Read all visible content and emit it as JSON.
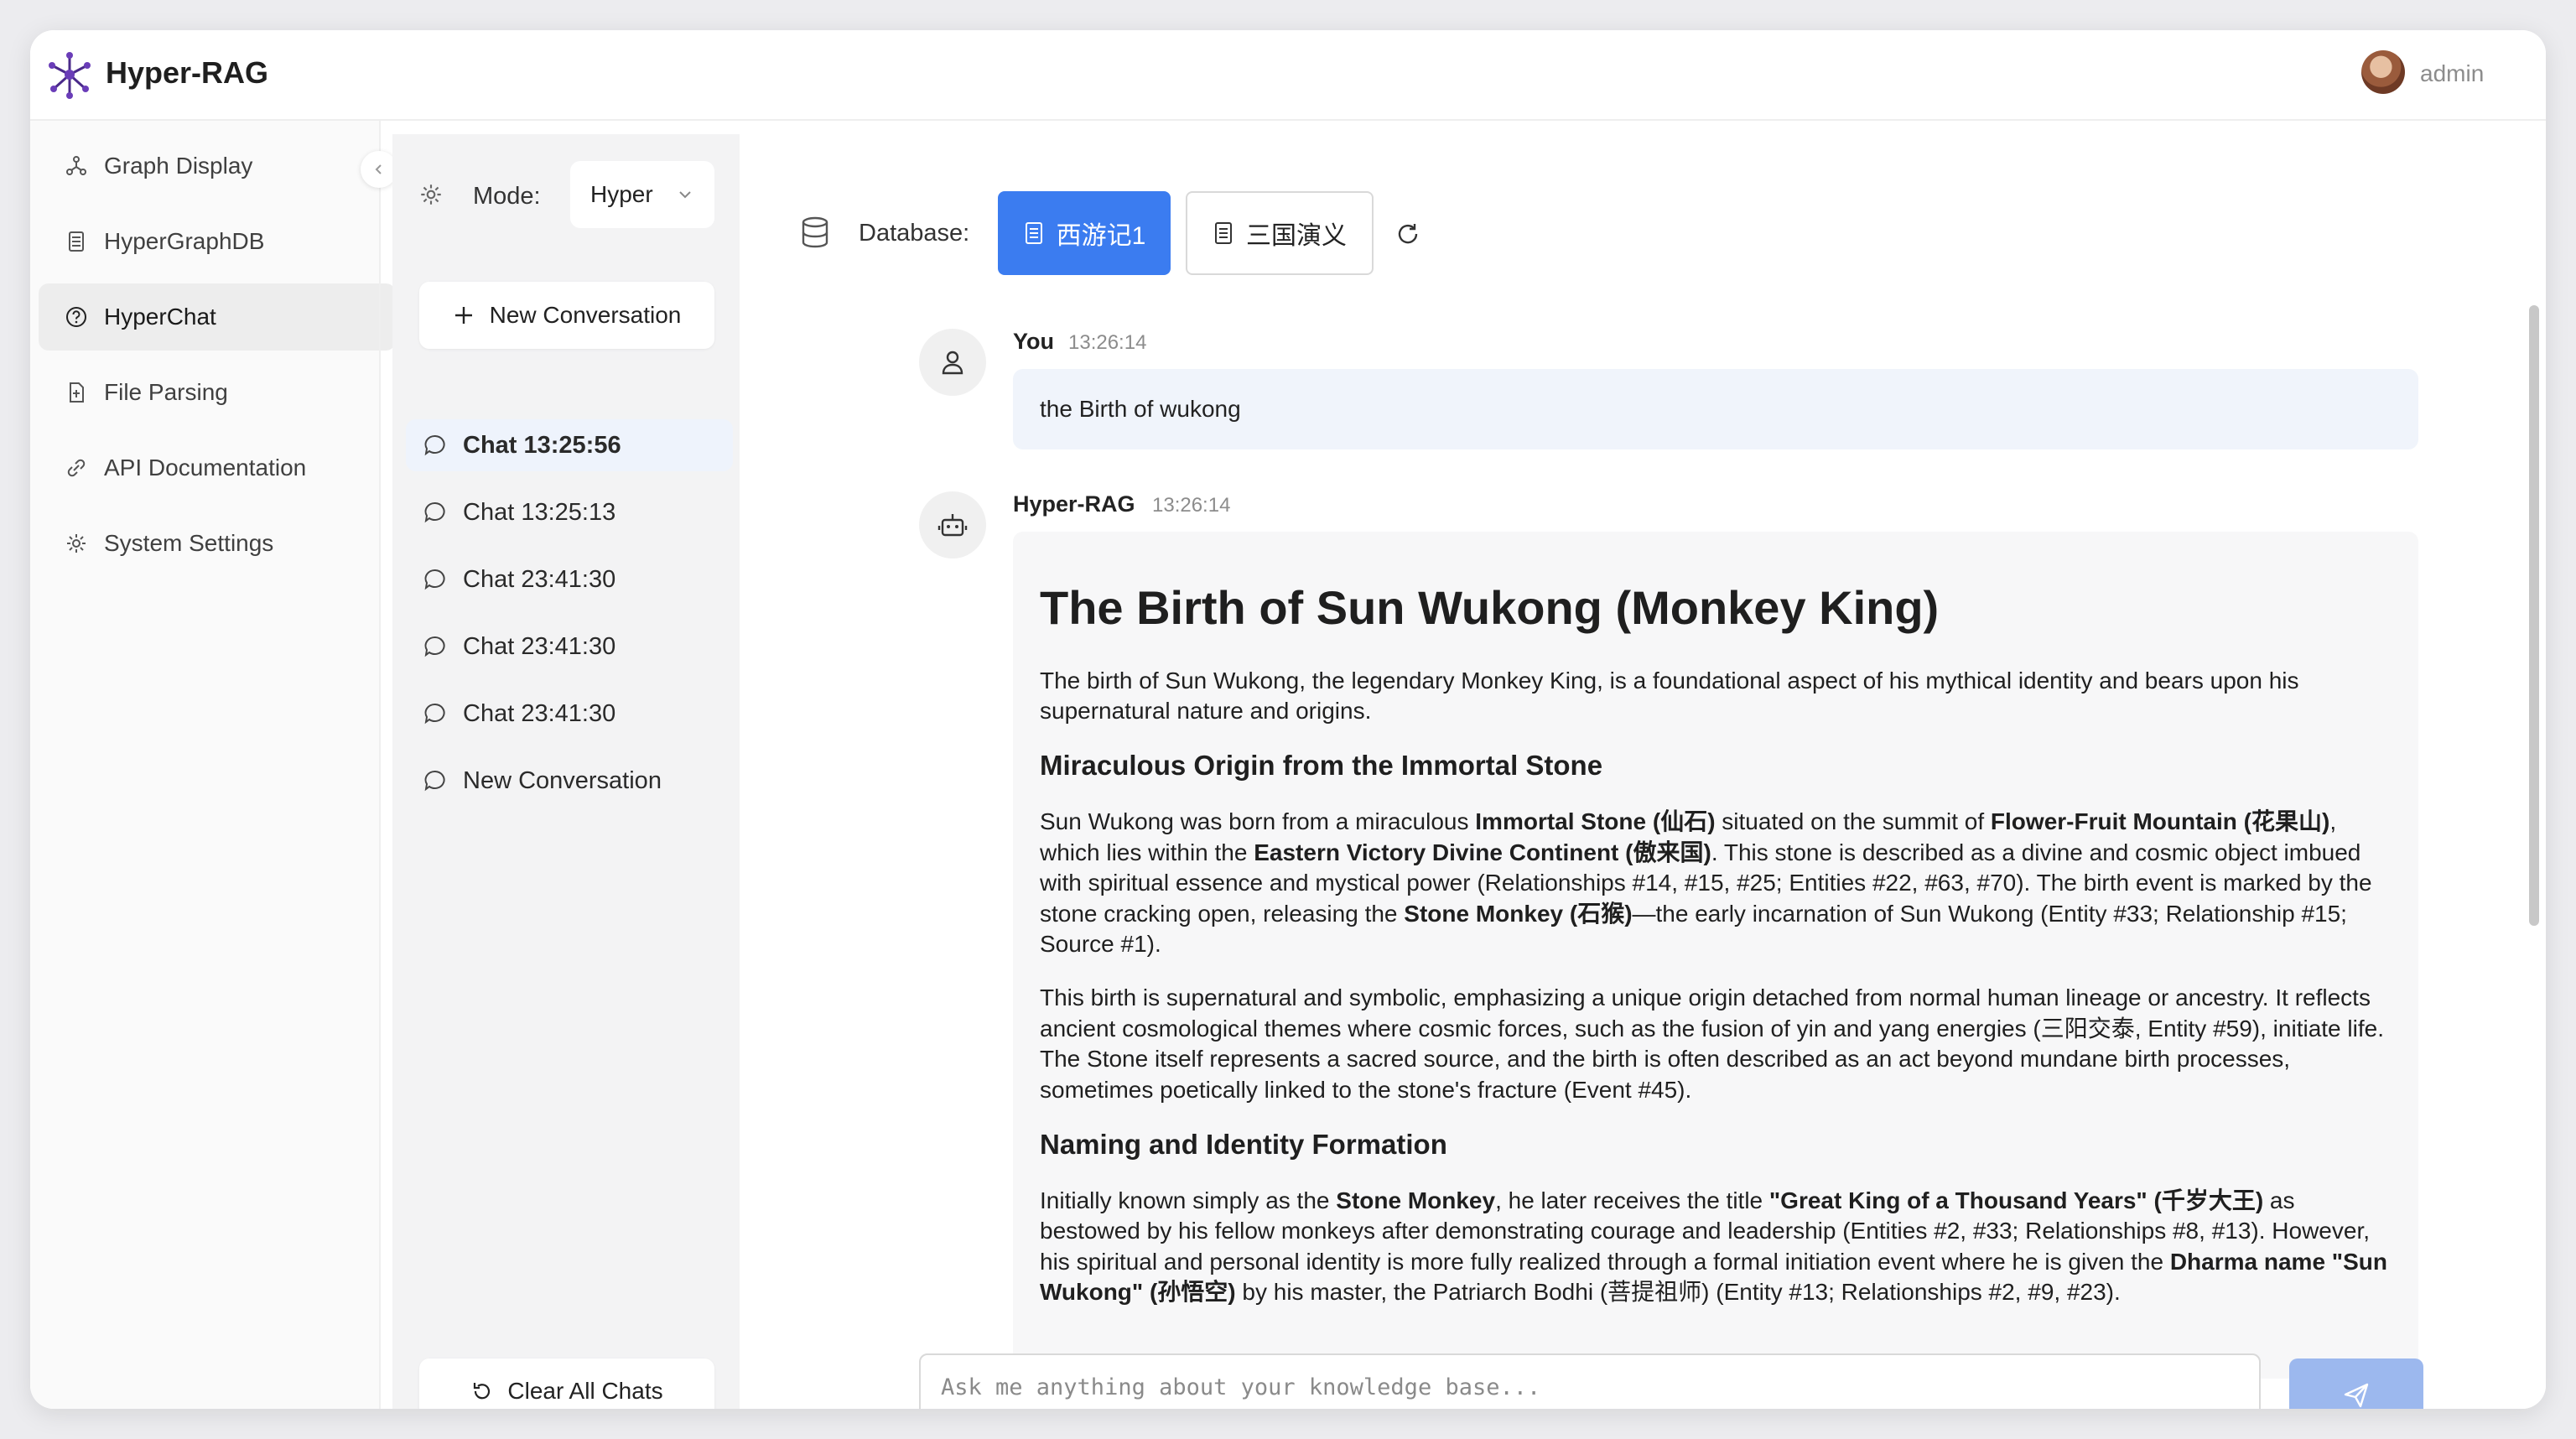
{
  "app": {
    "title": "Hyper-RAG"
  },
  "user": {
    "name": "admin"
  },
  "nav": {
    "items": [
      {
        "label": "Graph Display",
        "icon": "graph-icon",
        "active": false
      },
      {
        "label": "HyperGraphDB",
        "icon": "database-doc-icon",
        "active": false
      },
      {
        "label": "HyperChat",
        "icon": "question-circle-icon",
        "active": true
      },
      {
        "label": "File Parsing",
        "icon": "file-icon",
        "active": false
      },
      {
        "label": "API Documentation",
        "icon": "api-link-icon",
        "active": false
      },
      {
        "label": "System Settings",
        "icon": "gear-icon",
        "active": false
      }
    ]
  },
  "chatlist": {
    "mode_label": "Mode:",
    "mode_value": "Hyper",
    "new_conversation_label": "New Conversation",
    "items": [
      {
        "label": "Chat 13:25:56",
        "active": true
      },
      {
        "label": "Chat 13:25:13",
        "active": false
      },
      {
        "label": "Chat 23:41:30",
        "active": false
      },
      {
        "label": "Chat 23:41:30",
        "active": false
      },
      {
        "label": "Chat 23:41:30",
        "active": false
      },
      {
        "label": "New Conversation",
        "active": false
      }
    ],
    "clear_label": "Clear All Chats"
  },
  "database": {
    "label": "Database:",
    "options": [
      {
        "label": "西游记1",
        "active": true
      },
      {
        "label": "三国演义",
        "active": false
      }
    ]
  },
  "messages": {
    "user": {
      "sender": "You",
      "time": "13:26:14",
      "text": "the Birth of wukong"
    },
    "bot": {
      "sender": "Hyper-RAG",
      "time": "13:26:14",
      "title": "The Birth of Sun Wukong (Monkey King)",
      "intro": "The birth of Sun Wukong, the legendary Monkey King, is a foundational aspect of his mythical identity and bears upon his supernatural nature and origins.",
      "section1_heading": "Miraculous Origin from the Immortal Stone",
      "p1": {
        "t1": "Sun Wukong was born from a miraculous ",
        "b1": "Immortal Stone (仙石)",
        "t2": " situated on the summit of ",
        "b2": "Flower-Fruit Mountain (花果山)",
        "t3": ", which lies within the ",
        "b3": "Eastern Victory Divine Continent (傲来国)",
        "t4": ". This stone is described as a divine and cosmic object imbued with spiritual essence and mystical power (Relationships #14, #15, #25; Entities #22, #63, #70). The birth event is marked by the stone cracking open, releasing the ",
        "b4": "Stone Monkey (石猴)",
        "t5": "—the early incarnation of Sun Wukong (Entity #33; Relationship #15; Source #1)."
      },
      "p2": "This birth is supernatural and symbolic, emphasizing a unique origin detached from normal human lineage or ancestry. It reflects ancient cosmological themes where cosmic forces, such as the fusion of yin and yang energies (三阳交泰, Entity #59), initiate life. The Stone itself represents a sacred source, and the birth is often described as an act beyond mundane birth processes, sometimes poetically linked to the stone's fracture (Event #45).",
      "section2_heading": "Naming and Identity Formation",
      "p3": {
        "t1": "Initially known simply as the ",
        "b1": "Stone Monkey",
        "t2": ", he later receives the title ",
        "b2": "\"Great King of a Thousand Years\" (千岁大王)",
        "t3": " as bestowed by his fellow monkeys after demonstrating courage and leadership (Entities #2, #33; Relationships #8, #13). However, his spiritual and personal identity is more fully realized through a formal initiation event where he is given the ",
        "b3": "Dharma name \"Sun Wukong\" (孙悟空)",
        "t4": " by his master, the Patriarch Bodhi (菩提祖师) (Entity #13; Relationships #2, #9, #23)."
      }
    }
  },
  "composer": {
    "placeholder": "Ask me anything about your knowledge base..."
  },
  "colors": {
    "accent": "#3b7cf0",
    "send_disabled": "#9cb8ee",
    "user_bubble": "#f0f4fb"
  }
}
